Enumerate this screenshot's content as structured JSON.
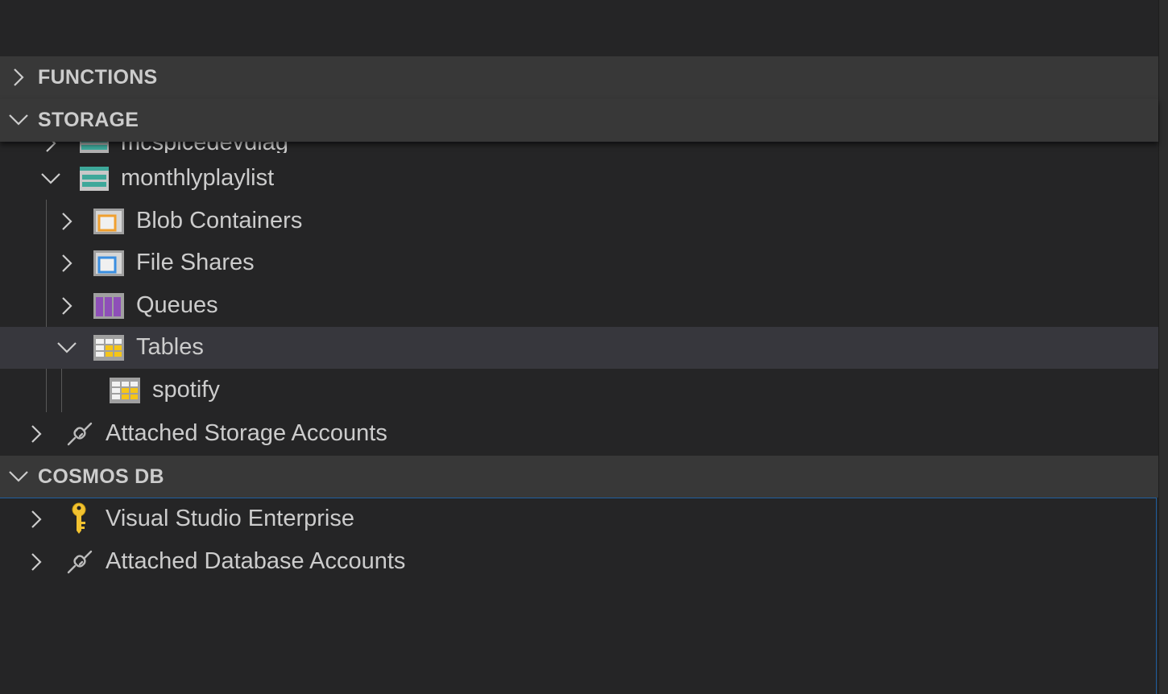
{
  "sections": {
    "functions": {
      "label": "FUNCTIONS",
      "expanded": false
    },
    "storage": {
      "label": "STORAGE",
      "expanded": true
    },
    "cosmos": {
      "label": "COSMOS DB",
      "expanded": true
    }
  },
  "storage_tree": {
    "partial_account": {
      "label": "mcspicedevdiag"
    },
    "account": {
      "label": "monthlyplaylist",
      "expanded": true
    },
    "children": {
      "blob": {
        "label": "Blob Containers",
        "icon": "blob-container-icon"
      },
      "file": {
        "label": "File Shares",
        "icon": "file-share-icon"
      },
      "queues": {
        "label": "Queues",
        "icon": "queue-icon"
      },
      "tables": {
        "label": "Tables",
        "icon": "table-icon",
        "expanded": true,
        "selected": true
      }
    },
    "table_item": {
      "label": "spotify",
      "icon": "table-icon"
    },
    "attached": {
      "label": "Attached Storage Accounts",
      "icon": "plug-icon"
    }
  },
  "cosmos_tree": {
    "subscription": {
      "label": "Visual Studio Enterprise",
      "icon": "key-icon"
    },
    "attached": {
      "label": "Attached Database Accounts",
      "icon": "plug-icon"
    }
  },
  "colors": {
    "background": "#252526",
    "section_header": "#383838",
    "selected_row": "#37373d",
    "focus_border": "#1f5f9f",
    "text": "#cccccc"
  }
}
